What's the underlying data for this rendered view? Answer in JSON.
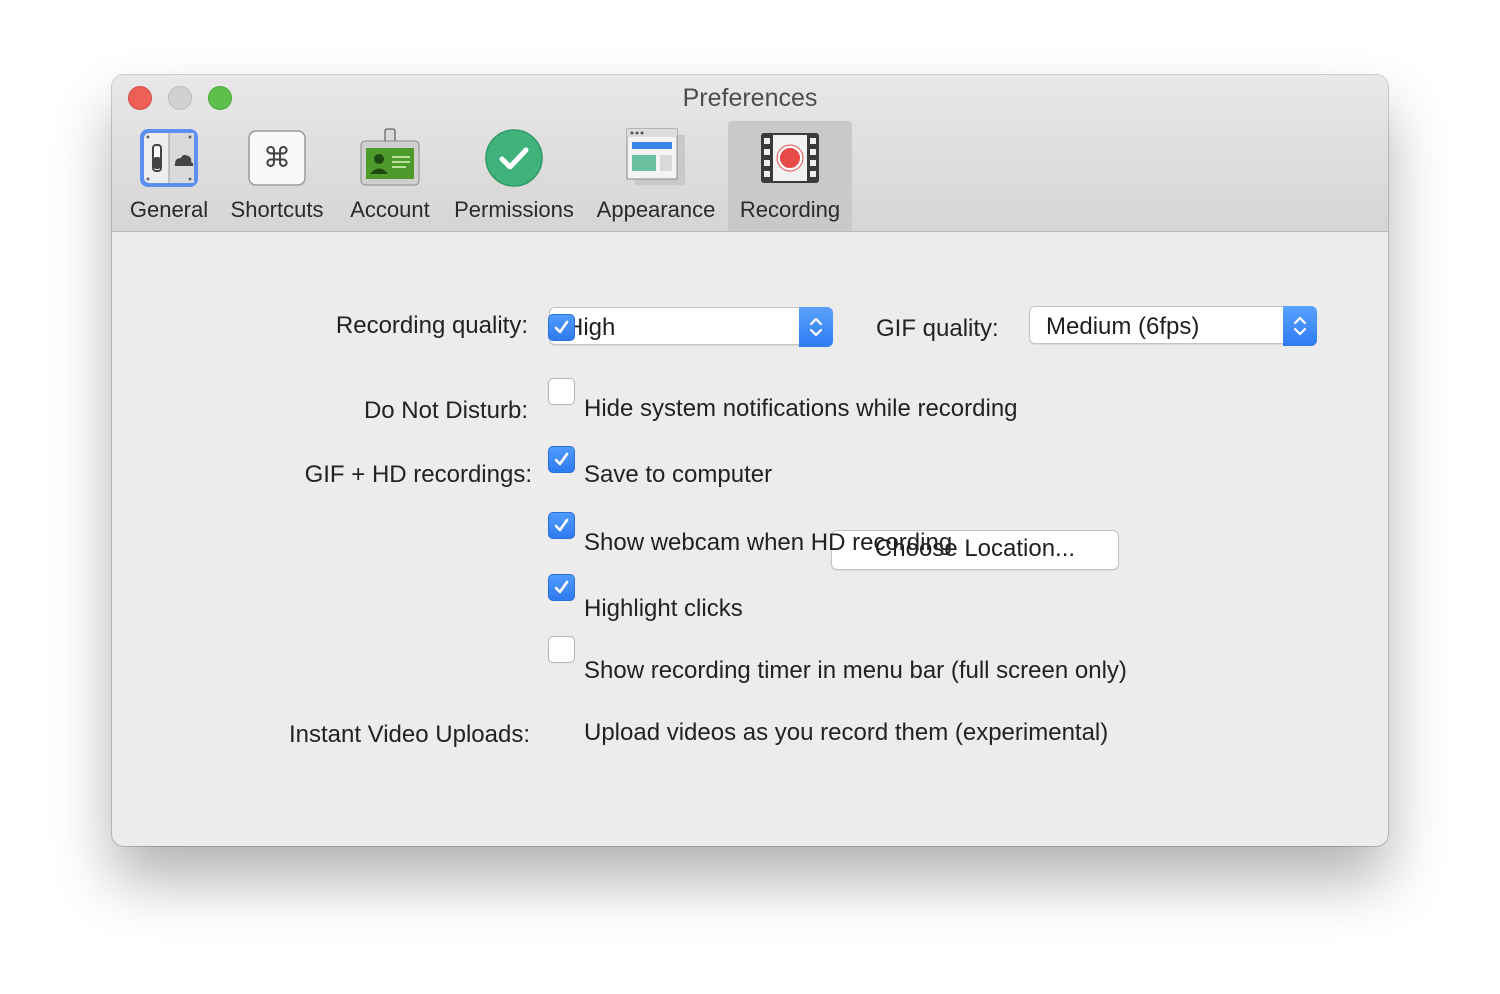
{
  "window": {
    "title": "Preferences"
  },
  "toolbar": {
    "tabs": [
      {
        "label": "General",
        "icon": "general-toggle-cloud-icon"
      },
      {
        "label": "Shortcuts",
        "icon": "command-key-icon"
      },
      {
        "label": "Account",
        "icon": "id-badge-icon"
      },
      {
        "label": "Permissions",
        "icon": "green-checkmark-icon"
      },
      {
        "label": "Appearance",
        "icon": "window-layout-icon"
      },
      {
        "label": "Recording",
        "icon": "film-record-icon"
      }
    ],
    "selected": "Recording"
  },
  "recording": {
    "quality_label": "Recording quality:",
    "quality_value": "High",
    "gif_quality_label": "GIF quality:",
    "gif_quality_value": "Medium (6fps)",
    "dnd_label": "Do Not Disturb:",
    "dnd_option": "Hide system notifications while recording",
    "dnd_checked": true,
    "gif_hd_label": "GIF + HD recordings:",
    "save_option": "Save to computer",
    "save_checked": false,
    "choose_location": "Choose Location...",
    "webcam_option": "Show webcam when HD recording",
    "webcam_checked": true,
    "highlight_option": "Highlight clicks",
    "highlight_checked": true,
    "timer_option": "Show recording timer in menu bar (full screen only)",
    "timer_checked": true,
    "instant_label": "Instant Video Uploads:",
    "instant_option": "Upload videos as you record them (experimental)",
    "instant_checked": false
  },
  "colors": {
    "accent": "#3a86f7",
    "close": "#ed5f57",
    "zoom": "#5dc04c",
    "record_red": "#e84a4a"
  }
}
